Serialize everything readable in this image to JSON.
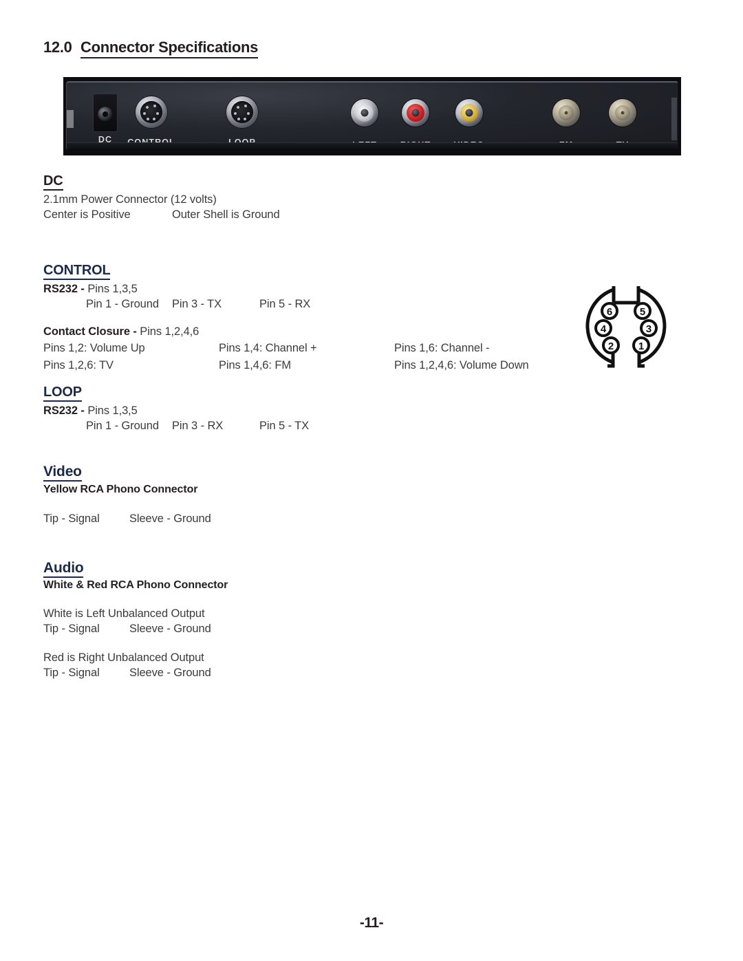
{
  "document": {
    "section_number": "12.0",
    "section_title": "Connector Specifications",
    "page_number": "-11-"
  },
  "device_panel": {
    "alt": "rear panel of receiver showing connectors",
    "ports": [
      {
        "label": "DC",
        "type": "barrel-power-jack"
      },
      {
        "label": "CONTROL",
        "type": "mini-din-6"
      },
      {
        "label": "LOOP",
        "type": "mini-din-6"
      },
      {
        "label": "LEFT",
        "type": "rca",
        "color": "#ffffff"
      },
      {
        "label": "RIGHT",
        "type": "rca",
        "color": "#cf1f22"
      },
      {
        "label": "VIDEO",
        "type": "rca",
        "color": "#d8b13d"
      },
      {
        "label": "FM",
        "type": "f-connector"
      },
      {
        "label": "TV",
        "type": "f-connector"
      }
    ]
  },
  "sections": {
    "dc": {
      "heading": "DC",
      "line1": "2.1mm Power Connector (12 volts)",
      "line2_a": "Center is Positive",
      "line2_b": "Outer Shell is Ground"
    },
    "control": {
      "heading": "CONTROL",
      "rs232_label": "RS232 -",
      "rs232_pins": " Pins 1,3,5",
      "rs232_detail_a": "Pin 1 - Ground",
      "rs232_detail_b": "Pin 3 - TX",
      "rs232_detail_c": "Pin 5 - RX",
      "contact_label": "Contact Closure -",
      "contact_pins": " Pins 1,2,4,6",
      "contact_rows": [
        [
          "Pins 1,2:  Volume Up",
          "Pins 1,4: Channel +",
          "Pins 1,6: Channel -"
        ],
        [
          "Pins 1,2,6: TV",
          "Pins 1,4,6: FM",
          "Pins 1,2,4,6:  Volume Down"
        ]
      ]
    },
    "loop": {
      "heading": "LOOP",
      "rs232_label": "RS232 -",
      "rs232_pins": " Pins 1,3,5",
      "rs232_detail_a": "Pin 1 - Ground",
      "rs232_detail_b": "Pin 3 - RX",
      "rs232_detail_c": "Pin 5 - TX"
    },
    "video": {
      "heading": "Video",
      "subheading": "Yellow RCA Phono Connector",
      "tip": "Tip - Signal",
      "sleeve": "Sleeve - Ground"
    },
    "audio": {
      "heading": "Audio",
      "subheading": "White & Red RCA Phono Connector",
      "white_line": "White is Left Unbalanced Output",
      "white_tip": "Tip - Signal",
      "white_sleeve": "Sleeve - Ground",
      "red_line": "Red is Right Unbalanced Output",
      "red_tip": "Tip - Signal",
      "red_sleeve": "Sleeve - Ground"
    }
  },
  "pin_diagram": {
    "type": "mini-din-6-female-panel-view",
    "pins": [
      "6",
      "5",
      "4",
      "3",
      "2",
      "1"
    ]
  }
}
